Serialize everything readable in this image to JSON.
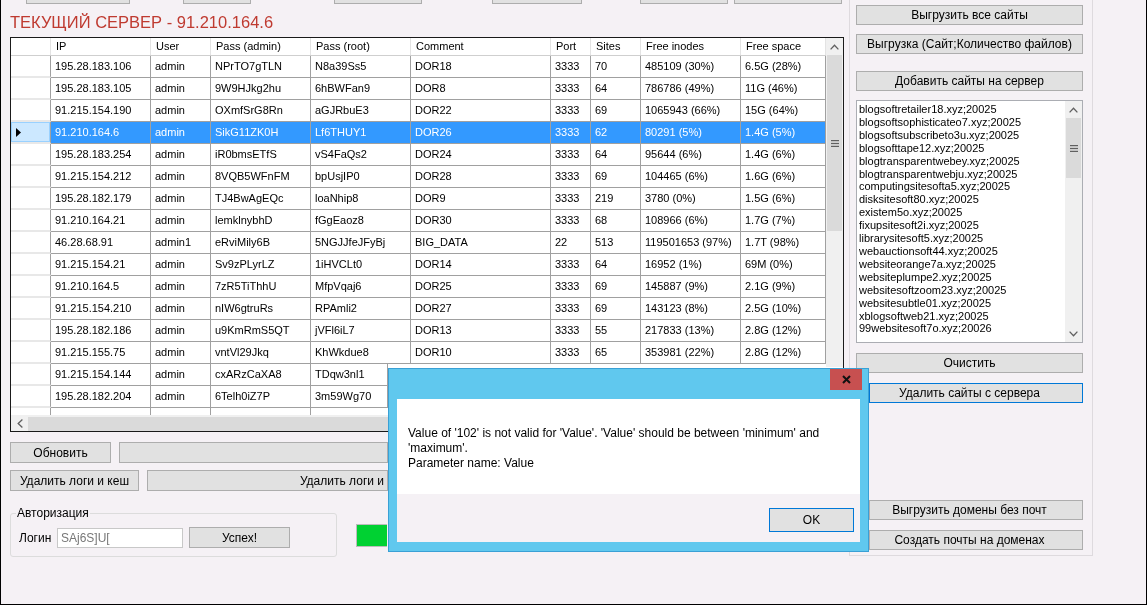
{
  "title": "ТЕКУЩИЙ СЕРВЕР - 91.210.164.6",
  "table": {
    "columns": [
      "IP",
      "User",
      "Pass (admin)",
      "Pass (root)",
      "Comment",
      "Port",
      "Sites",
      "Free inodes",
      "Free space"
    ],
    "rows": [
      {
        "selected": false,
        "cells": [
          "195.28.183.106",
          "admin",
          "NPrTO7gTLN",
          "N8a39Ss5",
          "DOR18",
          "3333",
          "70",
          "485109 (30%)",
          "6.5G (28%)"
        ]
      },
      {
        "selected": false,
        "cells": [
          "195.28.183.105",
          "admin",
          "9W9HJkg2hu",
          "6hBWFan9",
          "DOR8",
          "3333",
          "64",
          "786786 (49%)",
          "11G (46%)"
        ]
      },
      {
        "selected": false,
        "cells": [
          "91.215.154.190",
          "admin",
          "OXmfSrG8Rn",
          "aGJRbuE3",
          "DOR22",
          "3333",
          "69",
          "1065943 (66%)",
          "15G (64%)"
        ]
      },
      {
        "selected": true,
        "cells": [
          "91.210.164.6",
          "admin",
          "SikG11ZK0H",
          "Lf6THUY1",
          "DOR26",
          "3333",
          "62",
          "80291 (5%)",
          "1.4G (5%)"
        ]
      },
      {
        "selected": false,
        "cells": [
          "195.28.183.254",
          "admin",
          "iR0bmsETfS",
          "vS4FaQs2",
          "DOR24",
          "3333",
          "64",
          "95644 (6%)",
          "1.4G (6%)"
        ]
      },
      {
        "selected": false,
        "cells": [
          "91.215.154.212",
          "admin",
          "8VQB5WFnFM",
          "bpUsjIP0",
          "DOR28",
          "3333",
          "69",
          "104465 (6%)",
          "1.6G (6%)"
        ]
      },
      {
        "selected": false,
        "cells": [
          "195.28.182.179",
          "admin",
          "TJ4BwAgEQc",
          "loaNhip8",
          "DOR9",
          "3333",
          "219",
          "3780 (0%)",
          "1.5G (6%)"
        ]
      },
      {
        "selected": false,
        "cells": [
          "91.210.164.21",
          "admin",
          "lemklnybhD",
          "fGgEaoz8",
          "DOR30",
          "3333",
          "68",
          "108966 (6%)",
          "1.7G (7%)"
        ]
      },
      {
        "selected": false,
        "cells": [
          "46.28.68.91",
          "admin1",
          "eRviMily6B",
          "5NGJJfeJFyBj",
          "BIG_DATA",
          "22",
          "513",
          "119501653 (97%)",
          "1.7T (98%)"
        ]
      },
      {
        "selected": false,
        "cells": [
          "91.215.154.21",
          "admin",
          "Sv9zPLyrLZ",
          "1iHVCLt0",
          "DOR14",
          "3333",
          "64",
          "16952 (1%)",
          "69M (0%)"
        ]
      },
      {
        "selected": false,
        "cells": [
          "91.210.164.5",
          "admin",
          "7zR5TiThhU",
          "MfpVqaj6",
          "DOR25",
          "3333",
          "69",
          "145887 (9%)",
          "2.1G (9%)"
        ]
      },
      {
        "selected": false,
        "cells": [
          "91.215.154.210",
          "admin",
          "nIW6gtruRs",
          "RPAmli2",
          "DOR27",
          "3333",
          "69",
          "143123 (8%)",
          "2.5G (10%)"
        ]
      },
      {
        "selected": false,
        "cells": [
          "195.28.182.186",
          "admin",
          "u9KmRmS5QT",
          "jVFl6iL7",
          "DOR13",
          "3333",
          "55",
          "217833 (13%)",
          "2.8G (12%)"
        ]
      },
      {
        "selected": false,
        "cells": [
          "91.215.155.75",
          "admin",
          "vntVl29Jkq",
          "KhWkdue8",
          "DOR10",
          "3333",
          "65",
          "353981 (22%)",
          "2.8G (12%)"
        ]
      },
      {
        "selected": false,
        "cells": [
          "91.215.154.144",
          "admin",
          "cxARzCaXA8",
          "TDqw3nl1"
        ]
      },
      {
        "selected": false,
        "cells": [
          "195.28.182.204",
          "admin",
          "6Telh0iZ7P",
          "3m59Wg70"
        ]
      }
    ]
  },
  "button_rows": [
    {
      "button": "Обновить"
    },
    {
      "button": "Удалить логи и кеш",
      "wide_button": "Удалить логи и"
    }
  ],
  "auth": {
    "legend": "Авторизация",
    "login_label": "Логин",
    "login_value": "SAj6S]U[",
    "login_disabled": true,
    "button": "Успех!"
  },
  "progress": {
    "level": 1
  },
  "side_panel": {
    "top_buttons": [
      {
        "label": "Выгрузить все сайты",
        "focused": false
      },
      {
        "label": "Выгрузка (Сайт;Количество файлов)",
        "focused": false
      },
      {
        "label": "Добавить сайты на сервер",
        "focused": false
      }
    ],
    "sites": [
      "blogsoftretailer18.xyz;20025",
      "blogsoftsophisticateo7.xyz;20025",
      "blogsoftsubscribeto3u.xyz;20025",
      "blogsofttape12.xyz;20025",
      "blogtransparentwebey.xyz;20025",
      "blogtransparentwebju.xyz;20025",
      "computingsitesofta5.xyz;20025",
      "disksitesoft80.xyz;20025",
      "existem5o.xyz;20025",
      "fixupsitesoft2i.xyz;20025",
      "librarysitesoft5.xyz;20025",
      "webauctionsoft44.xyz;20025",
      "websiteorange7a.xyz;20025",
      "websiteplumpe2.xyz;20025",
      "websitesoftzoom23.xyz;20025",
      "websitesubtle01.xyz;20025",
      "xblogsoftweb21.xyz;20025",
      "99websitesoft7o.xyz;20026"
    ],
    "middle_buttons": [
      {
        "label": "Очистить",
        "focused": false
      },
      {
        "label": "Удалить сайты с сервера",
        "focused": true
      }
    ],
    "bottom_buttons": [
      {
        "label": "Выгрузить домены без почт",
        "focused": false
      },
      {
        "label": "Создать почты на доменах",
        "focused": false
      }
    ]
  },
  "dialog": {
    "message": "Value of '102' is not valid for 'Value'. 'Value' should be between 'minimum' and 'maximum'.",
    "detail": "Parameter name: Value",
    "button": {
      "label": "OK",
      "focused": true
    }
  }
}
